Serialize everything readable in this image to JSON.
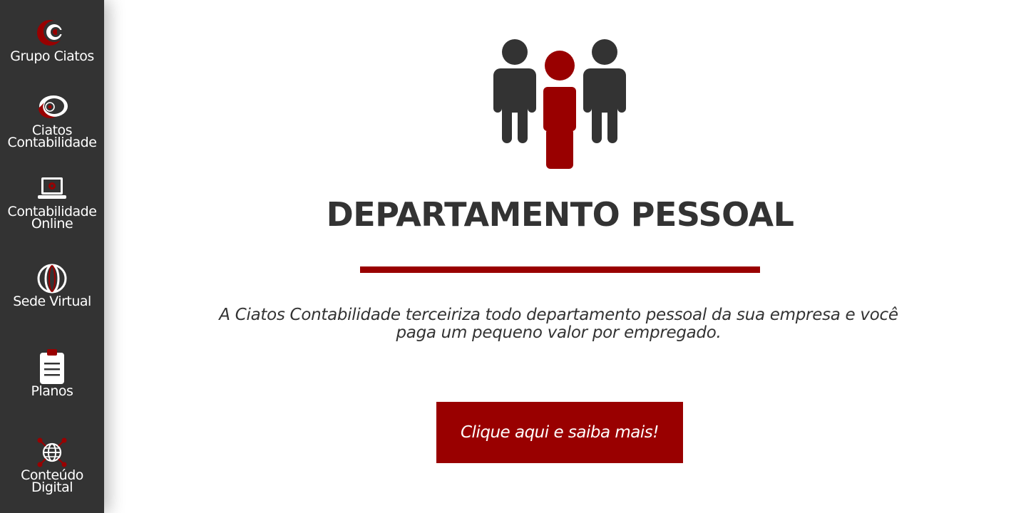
{
  "colors": {
    "sidebar_bg": "#333333",
    "accent_red": "#990000",
    "heading_text": "#333333",
    "page_bg": "#ffffff"
  },
  "sidebar": {
    "items": [
      {
        "label": "Grupo Ciatos",
        "icon": "ciatos-logo-icon"
      },
      {
        "label": "Ciatos\nContabilidade",
        "icon": "ciatos-contabilidade-logo-icon"
      },
      {
        "label": "Contabilidade\nOnline",
        "icon": "laptop-icon"
      },
      {
        "label": "Sede Virtual",
        "icon": "globe-icon"
      },
      {
        "label": "Planos",
        "icon": "clipboard-icon"
      },
      {
        "label": "Conteúdo\nDigital",
        "icon": "network-globe-icon"
      }
    ]
  },
  "main": {
    "hero_icon": "people-group-icon",
    "title": "DEPARTAMENTO PESSOAL",
    "description": "A Ciatos Contabilidade terceiriza todo departamento pessoal da sua empresa e você paga um pequeno valor por empregado.",
    "cta_label": "Clique aqui e saiba mais!"
  }
}
